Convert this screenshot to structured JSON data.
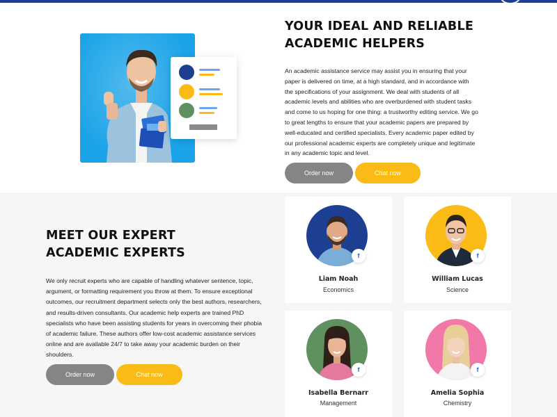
{
  "section_helpers": {
    "title_line1": "YOUR IDEAL AND RELIABLE",
    "title_line2": "ACADEMIC HELPERS",
    "paragraph_lines": [
      "An academic assistance service may assist you in ensuring that your",
      "paper is delivered on time, at a high standard, and in accordance with",
      "the specifications of your assignment. We deal with students of all",
      "academic levels and abilities who are overburdened with student tasks",
      "and come to us hoping for one thing: a trustworthy editing service. We go",
      "to great lengths to ensure that your academic papers are prepared by",
      "well-educated and certified specialists. Every academic paper edited by",
      "our professional academic experts are completely unique and legitimate",
      "in any academic topic and level."
    ],
    "order_label": "Order now",
    "chat_label": "Chat now"
  },
  "section_experts": {
    "title_line1": "MEET OUR EXPERT",
    "title_line2": "ACADEMIC EXPERTS",
    "paragraph_lines": [
      "We only recruit experts who are capable of handling whatever sentence, topic,",
      "argument, or formatting requirement you throw at them. To ensure exceptional",
      "outcomes, our recruitment department selects only the best authors, researchers,",
      "and results-driven consultants. Our academic help experts are trained PhD",
      "specialists who have been assisting students for years in overcoming their phobia",
      "of academic failure. These authors offer low-cost academic assistance services",
      "online and are available 24/7 to take away your academic burden on their",
      "shoulders."
    ],
    "order_label": "Order now",
    "chat_label": "Chat now",
    "experts": [
      {
        "name": "Liam Noah",
        "subject": "Economics",
        "social": "f"
      },
      {
        "name": "William Lucas",
        "subject": "Science",
        "social": "f"
      },
      {
        "name": "Isabella Bernarr",
        "subject": "Management",
        "social": "f"
      },
      {
        "name": "Amelia Sophia",
        "subject": "Chemistry",
        "social": "f"
      }
    ]
  },
  "colors": {
    "brand_blue": "#1d3f91",
    "button_gray": "#858585",
    "button_yellow": "#fbbb16",
    "hero_bg": "#1aa3e8",
    "section_bg": "#f6f6f6"
  }
}
